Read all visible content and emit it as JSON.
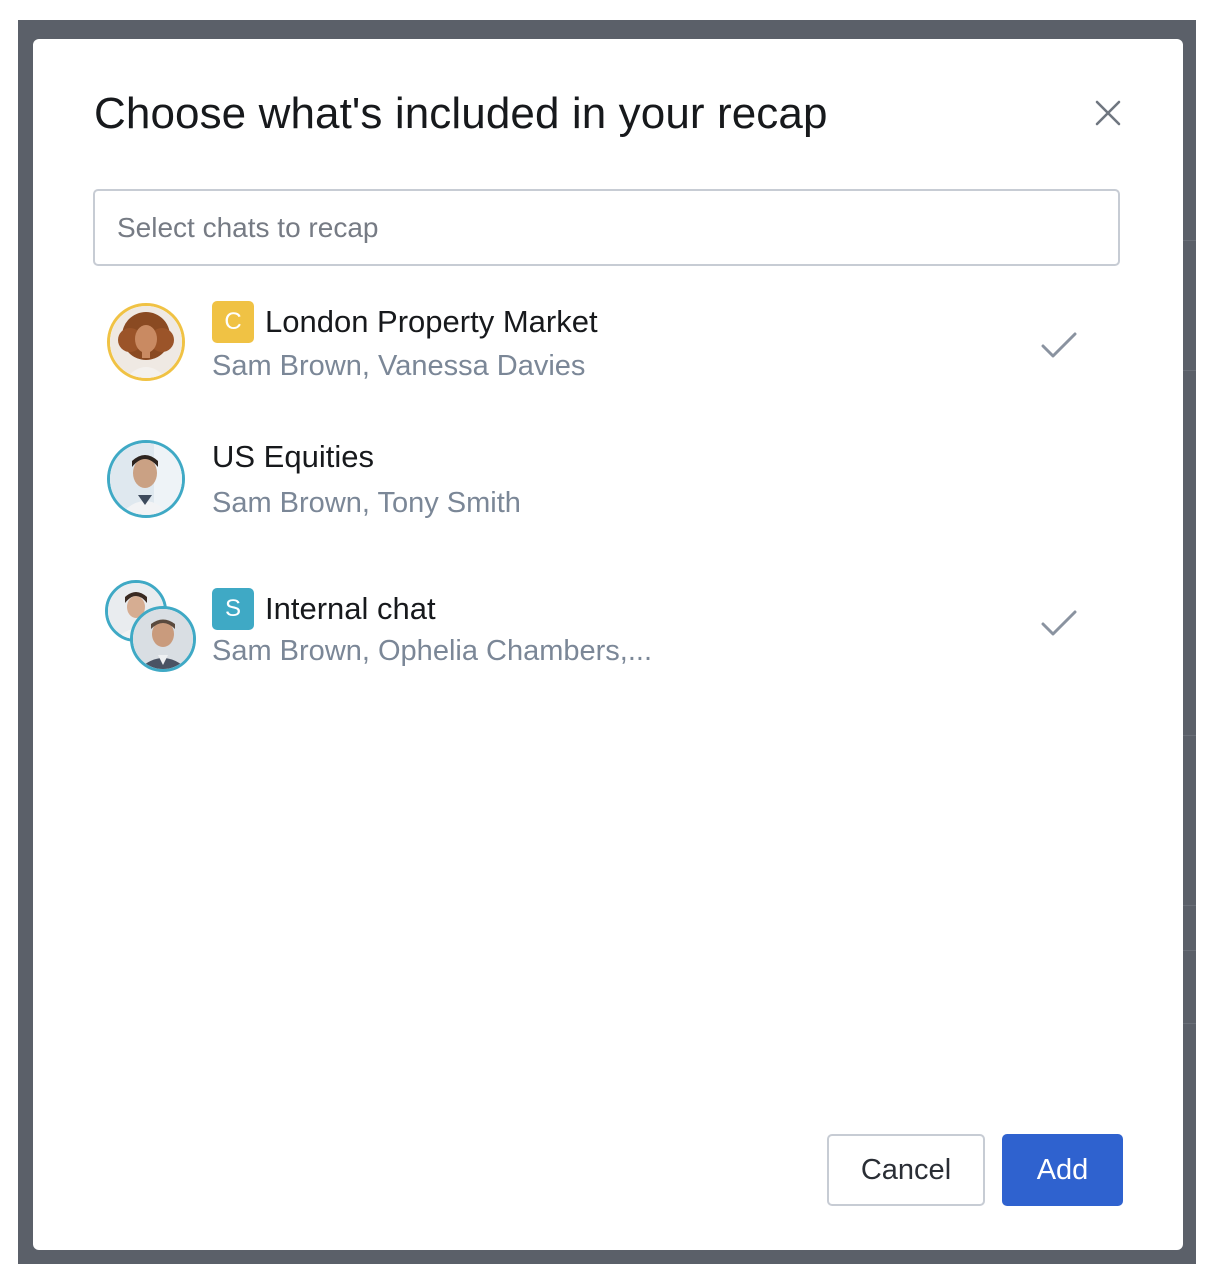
{
  "dialog": {
    "title": "Choose what's included in your recap",
    "close_icon": "close-icon",
    "search_placeholder": "Select chats to recap"
  },
  "chats": [
    {
      "name": "London Property Market",
      "members": "Sam Brown, Vanessa Davies",
      "badge": "C",
      "badge_color": "#f0c244",
      "avatar_ring_color": "#f0c244",
      "selected": true
    },
    {
      "name": "US Equities",
      "members": "Sam Brown, Tony Smith",
      "badge": "",
      "avatar_ring_color": "#3fa9c5",
      "selected": false
    },
    {
      "name": "Internal chat",
      "members": "Sam Brown, Ophelia Chambers,...",
      "badge": "S",
      "badge_color": "#3fa9c5",
      "avatar_ring_color": "#3fa9c5",
      "selected": true
    }
  ],
  "footer": {
    "cancel_label": "Cancel",
    "add_label": "Add"
  },
  "colors": {
    "accent": "#2f62cf",
    "check": "#8a93a0",
    "overlay": "#5b6069"
  }
}
